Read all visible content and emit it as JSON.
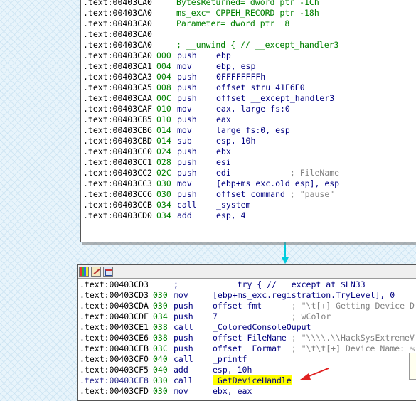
{
  "top_block": {
    "lines": [
      {
        "addr": ".text:00403CA0",
        "sp": "",
        "mn": "",
        "ops": "BytesReturned= dword ptr -1Ch",
        "cmt": "",
        "kind": "def"
      },
      {
        "addr": ".text:00403CA0",
        "sp": "",
        "mn": "",
        "ops": "ms_exc= CPPEH_RECORD ptr -18h",
        "cmt": "",
        "kind": "def"
      },
      {
        "addr": ".text:00403CA0",
        "sp": "",
        "mn": "",
        "ops": "Parameter= dword ptr  8",
        "cmt": "",
        "kind": "def"
      },
      {
        "addr": ".text:00403CA0",
        "sp": "",
        "mn": "",
        "ops": "",
        "cmt": "",
        "kind": "blank"
      },
      {
        "addr": ".text:00403CA0",
        "sp": "",
        "mn": "",
        "ops": "; __unwind { // __except_handler3",
        "cmt": "",
        "kind": "def"
      },
      {
        "addr": ".text:00403CA0",
        "sp": "000",
        "mn": "push",
        "ops": "ebp",
        "cmt": "",
        "kind": "code"
      },
      {
        "addr": ".text:00403CA1",
        "sp": "004",
        "mn": "mov",
        "ops": "ebp, esp",
        "cmt": "",
        "kind": "code"
      },
      {
        "addr": ".text:00403CA3",
        "sp": "004",
        "mn": "push",
        "ops": "0FFFFFFFFh",
        "cmt": "",
        "kind": "code"
      },
      {
        "addr": ".text:00403CA5",
        "sp": "008",
        "mn": "push",
        "ops": "offset stru_41F6E0",
        "cmt": "",
        "kind": "code"
      },
      {
        "addr": ".text:00403CAA",
        "sp": "00C",
        "mn": "push",
        "ops": "offset __except_handler3",
        "cmt": "",
        "kind": "code"
      },
      {
        "addr": ".text:00403CAF",
        "sp": "010",
        "mn": "mov",
        "ops": "eax, large fs:0",
        "cmt": "",
        "kind": "code"
      },
      {
        "addr": ".text:00403CB5",
        "sp": "010",
        "mn": "push",
        "ops": "eax",
        "cmt": "",
        "kind": "code"
      },
      {
        "addr": ".text:00403CB6",
        "sp": "014",
        "mn": "mov",
        "ops": "large fs:0, esp",
        "cmt": "",
        "kind": "code"
      },
      {
        "addr": ".text:00403CBD",
        "sp": "014",
        "mn": "sub",
        "ops": "esp, 10h",
        "cmt": "",
        "kind": "code"
      },
      {
        "addr": ".text:00403CC0",
        "sp": "024",
        "mn": "push",
        "ops": "ebx",
        "cmt": "",
        "kind": "code"
      },
      {
        "addr": ".text:00403CC1",
        "sp": "028",
        "mn": "push",
        "ops": "esi",
        "cmt": "",
        "kind": "code"
      },
      {
        "addr": ".text:00403CC2",
        "sp": "02C",
        "mn": "push",
        "ops": "edi",
        "cmt": "            ; FileName",
        "kind": "code"
      },
      {
        "addr": ".text:00403CC3",
        "sp": "030",
        "mn": "mov",
        "ops": "[ebp+ms_exc.old_esp], esp",
        "cmt": "",
        "kind": "code"
      },
      {
        "addr": ".text:00403CC6",
        "sp": "030",
        "mn": "push",
        "ops": "offset command",
        "cmt": " ; \"pause\"",
        "kind": "code"
      },
      {
        "addr": ".text:00403CCB",
        "sp": "034",
        "mn": "call",
        "ops": "_system",
        "cmt": "",
        "kind": "code"
      },
      {
        "addr": ".text:00403CD0",
        "sp": "034",
        "mn": "add",
        "ops": "esp, 4",
        "cmt": "",
        "kind": "code"
      }
    ]
  },
  "bottom_block": {
    "lines": [
      {
        "addr": ".text:00403CD3",
        "sp": "",
        "mn": ";",
        "ops": "   __try { // __except at $LN33",
        "cmt": "",
        "kind": "code"
      },
      {
        "addr": ".text:00403CD3",
        "sp": "030",
        "mn": "mov",
        "ops": "[ebp+ms_exc.registration.TryLevel], 0",
        "cmt": "",
        "kind": "code"
      },
      {
        "addr": ".text:00403CDA",
        "sp": "030",
        "mn": "push",
        "ops": "offset fmt",
        "cmt": "      ; \"\\t[+] Getting Device D",
        "kind": "code"
      },
      {
        "addr": ".text:00403CDF",
        "sp": "034",
        "mn": "push",
        "ops": "7",
        "cmt": "               ; wColor",
        "kind": "code"
      },
      {
        "addr": ".text:00403CE1",
        "sp": "038",
        "mn": "call",
        "ops": "_ColoredConsoleOuput",
        "cmt": "",
        "kind": "code"
      },
      {
        "addr": ".text:00403CE6",
        "sp": "038",
        "mn": "push",
        "ops": "offset FileName",
        "cmt": " ; \"\\\\\\\\.\\\\HackSysExtremeV",
        "kind": "code"
      },
      {
        "addr": ".text:00403CEB",
        "sp": "03C",
        "mn": "push",
        "ops": "offset _Format",
        "cmt": "  ; \"\\t\\t[+] Device Name: %",
        "kind": "code"
      },
      {
        "addr": ".text:00403CF0",
        "sp": "040",
        "mn": "call",
        "ops": "_printf",
        "cmt": "",
        "kind": "code"
      },
      {
        "addr": ".text:00403CF5",
        "sp": "040",
        "mn": "add",
        "ops": "esp, 10h",
        "cmt": "",
        "kind": "code"
      },
      {
        "addr": ".text:00403CF8",
        "sp": "030",
        "mn": "call",
        "ops": "_GetDeviceHandle",
        "cmt": "",
        "kind": "code",
        "highlight": true
      },
      {
        "addr": ".text:00403CFD",
        "sp": "030",
        "mn": "mov",
        "ops": "ebx, eax",
        "cmt": "",
        "kind": "code"
      }
    ]
  },
  "toolbar_icons": [
    "color-palette-icon",
    "edit-node-icon",
    "graph-overview-icon"
  ],
  "colors": {
    "address": "#000000",
    "stack_pointer": "#008000",
    "mnemonic": "#000080",
    "comment": "#808080",
    "highlight": "#ffff00",
    "arrow": "#00ccdd",
    "annotation_arrow": "#e02020"
  }
}
